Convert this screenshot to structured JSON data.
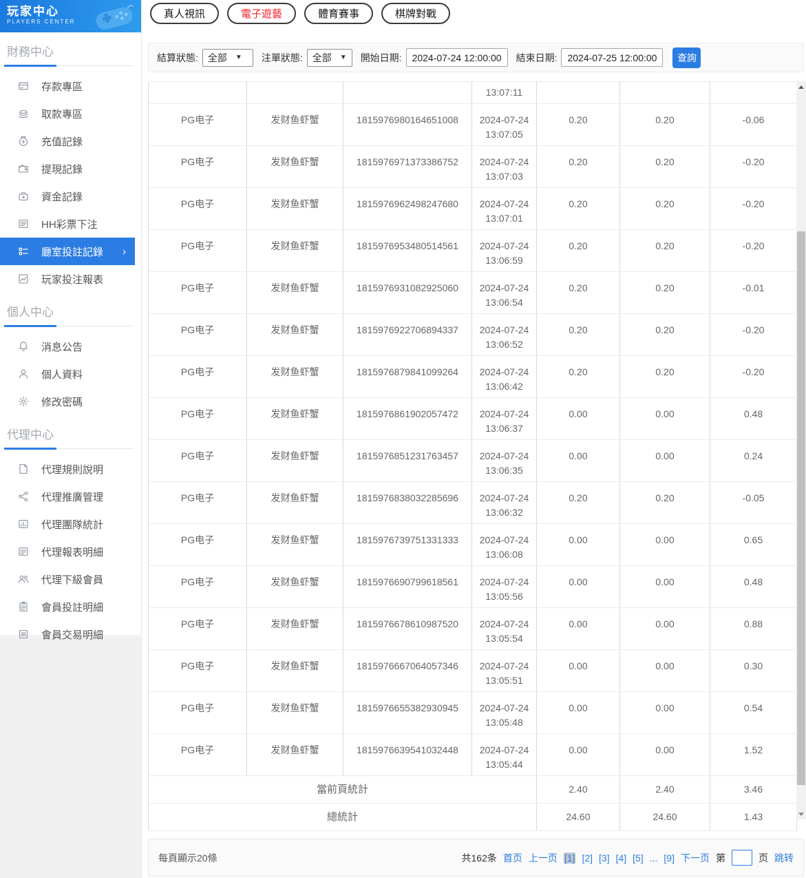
{
  "colors": {
    "accent_blue": "#2b7de3",
    "link_blue": "#2b7de3",
    "active_tab_red": "#f5222d",
    "header_gradient_start": "#1a79de",
    "header_gradient_end": "#2e9bee",
    "table_border_vertical": "#f3cdcd",
    "table_border_horizontal": "#ebebeb"
  },
  "sidebar": {
    "title": "玩家中心",
    "subtitle": "PLAYERS CENTER",
    "sections": [
      {
        "heading": "財務中心",
        "items": [
          {
            "label": "存款專區",
            "icon": "deposit-icon",
            "active": false
          },
          {
            "label": "取款專區",
            "icon": "withdraw-icon",
            "active": false
          },
          {
            "label": "充值記錄",
            "icon": "recharge-record-icon",
            "active": false
          },
          {
            "label": "提現記錄",
            "icon": "cashout-record-icon",
            "active": false
          },
          {
            "label": "資金記錄",
            "icon": "funds-record-icon",
            "active": false
          },
          {
            "label": "HH彩票下注",
            "icon": "lottery-icon",
            "active": false
          },
          {
            "label": "廳室投註記錄",
            "icon": "bet-records-icon",
            "active": true
          },
          {
            "label": "玩家投注報表",
            "icon": "bet-report-icon",
            "active": false
          }
        ]
      },
      {
        "heading": "個人中心",
        "items": [
          {
            "label": "消息公告",
            "icon": "bell-icon",
            "active": false
          },
          {
            "label": "個人資料",
            "icon": "profile-icon",
            "active": false
          },
          {
            "label": "修改密碼",
            "icon": "gear-icon",
            "active": false
          }
        ]
      },
      {
        "heading": "代理中心",
        "items": [
          {
            "label": "代理規則說明",
            "icon": "document-icon",
            "active": false
          },
          {
            "label": "代理推廣管理",
            "icon": "share-icon",
            "active": false
          },
          {
            "label": "代理團隊統計",
            "icon": "team-stats-icon",
            "active": false
          },
          {
            "label": "代理報表明細",
            "icon": "report-detail-icon",
            "active": false
          },
          {
            "label": "代理下級會員",
            "icon": "members-icon",
            "active": false
          },
          {
            "label": "會員投註明細",
            "icon": "member-bets-icon",
            "active": false
          },
          {
            "label": "會員交易明細",
            "icon": "member-trans-icon",
            "active": false
          }
        ]
      }
    ]
  },
  "tabs": [
    {
      "label": "真人視訊",
      "active": false
    },
    {
      "label": "電子遊藝",
      "active": true
    },
    {
      "label": "體育賽事",
      "active": false
    },
    {
      "label": "棋牌對戰",
      "active": false
    }
  ],
  "filters": {
    "settle_status_label": "結算狀態:",
    "settle_status_value": "全部",
    "order_status_label": "注單狀態:",
    "order_status_value": "全部",
    "start_label": "開始日期:",
    "start_value": "2024-07-24 12:00:00",
    "end_label": "結束日期:",
    "end_value": "2024-07-25 12:00:00",
    "search_label": "查詢"
  },
  "table": {
    "partial_row_time": "13:07:11",
    "rows": [
      {
        "platform": "PG电子",
        "game": "发财鱼虾蟹",
        "order": "1815976980164651008",
        "date": "2024-07-24",
        "time": "13:07:05",
        "bet": "0.20",
        "valid": "0.20",
        "profit": "-0.06"
      },
      {
        "platform": "PG电子",
        "game": "发财鱼虾蟹",
        "order": "1815976971373386752",
        "date": "2024-07-24",
        "time": "13:07:03",
        "bet": "0.20",
        "valid": "0.20",
        "profit": "-0.20"
      },
      {
        "platform": "PG电子",
        "game": "发财鱼虾蟹",
        "order": "1815976962498247680",
        "date": "2024-07-24",
        "time": "13:07:01",
        "bet": "0.20",
        "valid": "0.20",
        "profit": "-0.20"
      },
      {
        "platform": "PG电子",
        "game": "发财鱼虾蟹",
        "order": "1815976953480514561",
        "date": "2024-07-24",
        "time": "13:06:59",
        "bet": "0.20",
        "valid": "0.20",
        "profit": "-0.20"
      },
      {
        "platform": "PG电子",
        "game": "发财鱼虾蟹",
        "order": "1815976931082925060",
        "date": "2024-07-24",
        "time": "13:06:54",
        "bet": "0.20",
        "valid": "0.20",
        "profit": "-0.01"
      },
      {
        "platform": "PG电子",
        "game": "发财鱼虾蟹",
        "order": "1815976922706894337",
        "date": "2024-07-24",
        "time": "13:06:52",
        "bet": "0.20",
        "valid": "0.20",
        "profit": "-0.20"
      },
      {
        "platform": "PG电子",
        "game": "发财鱼虾蟹",
        "order": "1815976879841099264",
        "date": "2024-07-24",
        "time": "13:06:42",
        "bet": "0.20",
        "valid": "0.20",
        "profit": "-0.20"
      },
      {
        "platform": "PG电子",
        "game": "发财鱼虾蟹",
        "order": "1815976861902057472",
        "date": "2024-07-24",
        "time": "13:06:37",
        "bet": "0.00",
        "valid": "0.00",
        "profit": "0.48"
      },
      {
        "platform": "PG电子",
        "game": "发财鱼虾蟹",
        "order": "1815976851231763457",
        "date": "2024-07-24",
        "time": "13:06:35",
        "bet": "0.00",
        "valid": "0.00",
        "profit": "0.24"
      },
      {
        "platform": "PG电子",
        "game": "发财鱼虾蟹",
        "order": "1815976838032285696",
        "date": "2024-07-24",
        "time": "13:06:32",
        "bet": "0.20",
        "valid": "0.20",
        "profit": "-0.05"
      },
      {
        "platform": "PG电子",
        "game": "发财鱼虾蟹",
        "order": "1815976739751331333",
        "date": "2024-07-24",
        "time": "13:06:08",
        "bet": "0.00",
        "valid": "0.00",
        "profit": "0.65"
      },
      {
        "platform": "PG电子",
        "game": "发财鱼虾蟹",
        "order": "1815976690799618561",
        "date": "2024-07-24",
        "time": "13:05:56",
        "bet": "0.00",
        "valid": "0.00",
        "profit": "0.48"
      },
      {
        "platform": "PG电子",
        "game": "发财鱼虾蟹",
        "order": "1815976678610987520",
        "date": "2024-07-24",
        "time": "13:05:54",
        "bet": "0.00",
        "valid": "0.00",
        "profit": "0.88"
      },
      {
        "platform": "PG电子",
        "game": "发财鱼虾蟹",
        "order": "1815976667064057346",
        "date": "2024-07-24",
        "time": "13:05:51",
        "bet": "0.00",
        "valid": "0.00",
        "profit": "0.30"
      },
      {
        "platform": "PG电子",
        "game": "发财鱼虾蟹",
        "order": "1815976655382930945",
        "date": "2024-07-24",
        "time": "13:05:48",
        "bet": "0.00",
        "valid": "0.00",
        "profit": "0.54"
      },
      {
        "platform": "PG电子",
        "game": "发财鱼虾蟹",
        "order": "1815976639541032448",
        "date": "2024-07-24",
        "time": "13:05:44",
        "bet": "0.00",
        "valid": "0.00",
        "profit": "1.52"
      }
    ],
    "summary": [
      {
        "label": "當前頁統計",
        "bet": "2.40",
        "valid": "2.40",
        "profit": "3.46"
      },
      {
        "label": "總統計",
        "bet": "24.60",
        "valid": "24.60",
        "profit": "1.43"
      }
    ]
  },
  "pagination": {
    "page_size_text": "每頁顯示20條",
    "total_text": "共162条",
    "first_label": "首页",
    "prev_label": "上一页",
    "pages": [
      "[1]",
      "[2]",
      "[3]",
      "[4]",
      "[5]"
    ],
    "current_page": "[1]",
    "ellipsis": "...",
    "last_page": "[9]",
    "next_label": "下一页",
    "jump_prefix": "第",
    "jump_suffix": "页",
    "jump_action": "跳转"
  }
}
